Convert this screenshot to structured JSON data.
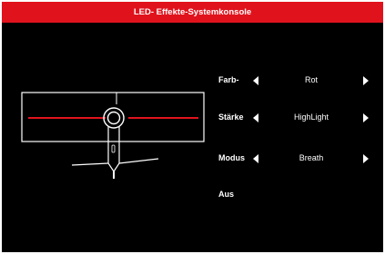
{
  "window": {
    "title": "LED- Effekte-Systemkonsole"
  },
  "settings": [
    {
      "label": "Farb-",
      "value": "Rot"
    },
    {
      "label": "Stärke",
      "value": "HighLight"
    },
    {
      "label": "Modus",
      "value": "Breath"
    }
  ],
  "off_label": "Aus",
  "colors": {
    "accent": "#e0131d",
    "background": "#000000",
    "led_line": "#e0131d"
  },
  "icons": {
    "prev": "triangle-left-icon",
    "next": "triangle-right-icon",
    "preview": "monitor-back-icon"
  }
}
